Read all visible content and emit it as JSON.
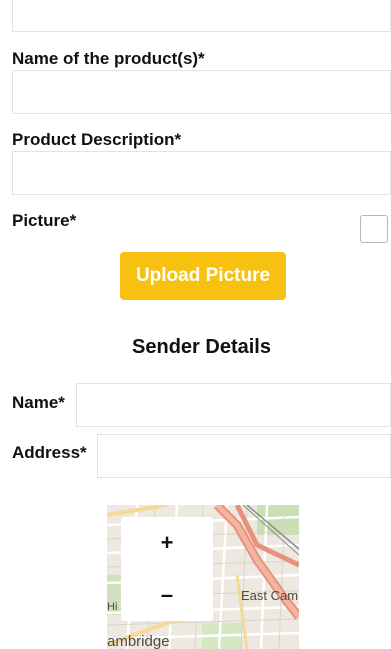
{
  "form": {
    "name_label": "Name of the product(s)*",
    "description_label": "Product Description*",
    "picture_label": "Picture*",
    "upload_button_label": "Upload Picture"
  },
  "sender": {
    "heading": "Sender Details",
    "name_label": "Name*",
    "address_label": "Address*"
  },
  "map": {
    "zoom_in_label": "+",
    "zoom_out_label": "–",
    "place_east": "East Camb",
    "place_cambridge": "ambridge",
    "place_hi": "Hi"
  },
  "colors": {
    "accent": "#f6c110",
    "input_border": "#e3e3e3"
  }
}
